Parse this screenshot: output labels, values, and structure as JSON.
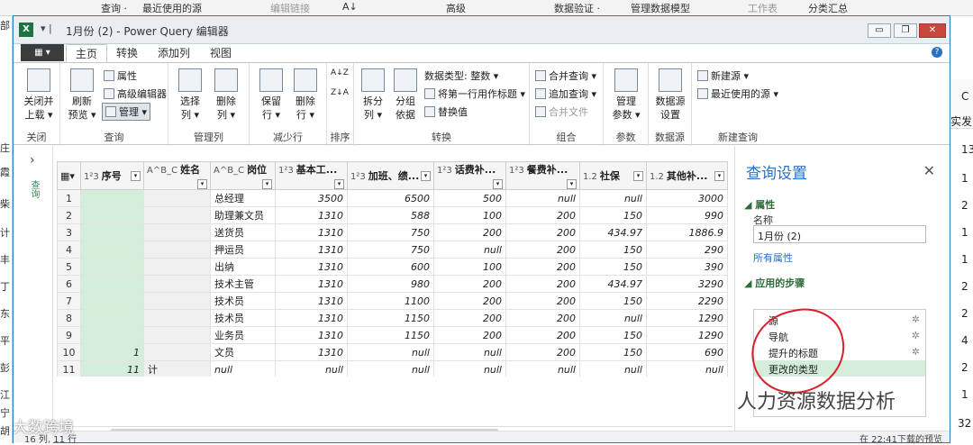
{
  "bg": {
    "toolbar": [
      "查询 ·",
      "最近使用的源",
      "编辑链接",
      "A↓",
      "高级",
      "数据验证 ·",
      "管理数据模型",
      "工作表",
      "分类汇总"
    ],
    "left_chars": [
      "部",
      "庄",
      "霞",
      "柴",
      "计",
      "丰",
      "丁",
      "东",
      "平",
      "彭",
      "江",
      "宁",
      "胡"
    ],
    "right_col": [
      "C",
      "实发",
      "13",
      "1",
      "2",
      "1",
      "1",
      "2",
      "2",
      "4",
      "2",
      "1",
      "32"
    ]
  },
  "window": {
    "title": "1月份 (2) - Power Query 编辑器",
    "qa": "▾ |",
    "minimize": "▭",
    "restore": "❐",
    "close": "✕"
  },
  "tabs": {
    "file": "▦ ▾",
    "items": [
      "主页",
      "转换",
      "添加列",
      "视图"
    ],
    "help": "?"
  },
  "ribbon": {
    "close_upload": [
      "关闭并",
      "上载 ▾"
    ],
    "refresh_preview": [
      "刷新",
      "预览 ▾"
    ],
    "properties": "属性",
    "advanced_editor": "高级编辑器",
    "manage": "管理 ▾",
    "choose_cols": [
      "选择",
      "列 ▾"
    ],
    "remove_cols": [
      "删除",
      "列 ▾"
    ],
    "keep_rows": [
      "保留",
      "行 ▾"
    ],
    "remove_rows": [
      "删除",
      "行 ▾"
    ],
    "sort_asc": "A↓Z",
    "sort_desc": "Z↓A",
    "split_col": [
      "拆分",
      "列 ▾"
    ],
    "group_by": [
      "分组",
      "依据"
    ],
    "data_type": "数据类型: 整数 ▾",
    "first_row_header": "将第一行用作标题 ▾",
    "replace_values": "替换值",
    "merge_queries": "合并查询 ▾",
    "append_queries": "追加查询 ▾",
    "combine_files": "合并文件",
    "manage_params": [
      "管理",
      "参数 ▾"
    ],
    "datasource_settings": [
      "数据源",
      "设置"
    ],
    "new_source": "新建源 ▾",
    "recent_sources": "最近使用的源 ▾",
    "groups": [
      "关闭",
      "查询",
      "管理列",
      "减少行",
      "排序",
      "转换",
      "组合",
      "参数",
      "数据源",
      "新建查询"
    ]
  },
  "nav": {
    "chevron": "›",
    "label": "查询"
  },
  "columns": [
    {
      "type": "1²3",
      "name": "序号"
    },
    {
      "type": "A^B_C",
      "name": "姓名"
    },
    {
      "type": "A^B_C",
      "name": "岗位"
    },
    {
      "type": "1²3",
      "name": "基本工..."
    },
    {
      "type": "1²3",
      "name": "加班、绩..."
    },
    {
      "type": "1²3",
      "name": "话费补..."
    },
    {
      "type": "1²3",
      "name": "餐费补..."
    },
    {
      "type": "1.2",
      "name": "社保"
    },
    {
      "type": "1.2",
      "name": "其他补..."
    }
  ],
  "rows": [
    {
      "n": "1",
      "seq": "",
      "name": "",
      "post": "总经理",
      "base": "3500",
      "bonus": "6500",
      "phone": "500",
      "meal": "null",
      "ss": "null",
      "other": "3000"
    },
    {
      "n": "2",
      "seq": "",
      "name": "",
      "post": "助理兼文员",
      "base": "1310",
      "bonus": "588",
      "phone": "100",
      "meal": "200",
      "ss": "150",
      "other": "990"
    },
    {
      "n": "3",
      "seq": "",
      "name": "",
      "post": "送货员",
      "base": "1310",
      "bonus": "750",
      "phone": "200",
      "meal": "200",
      "ss": "434.97",
      "other": "1886.9"
    },
    {
      "n": "4",
      "seq": "",
      "name": "",
      "post": "押运员",
      "base": "1310",
      "bonus": "750",
      "phone": "null",
      "meal": "200",
      "ss": "150",
      "other": "290"
    },
    {
      "n": "5",
      "seq": "",
      "name": "",
      "post": "出纳",
      "base": "1310",
      "bonus": "600",
      "phone": "100",
      "meal": "200",
      "ss": "150",
      "other": "390"
    },
    {
      "n": "6",
      "seq": "",
      "name": "",
      "post": "技术主管",
      "base": "1310",
      "bonus": "980",
      "phone": "200",
      "meal": "200",
      "ss": "434.97",
      "other": "3290"
    },
    {
      "n": "7",
      "seq": "",
      "name": "",
      "post": "技术员",
      "base": "1310",
      "bonus": "1100",
      "phone": "200",
      "meal": "200",
      "ss": "150",
      "other": "2290"
    },
    {
      "n": "8",
      "seq": "",
      "name": "",
      "post": "技术员",
      "base": "1310",
      "bonus": "1150",
      "phone": "200",
      "meal": "200",
      "ss": "null",
      "other": "1290"
    },
    {
      "n": "9",
      "seq": "",
      "name": "",
      "post": "业务员",
      "base": "1310",
      "bonus": "1150",
      "phone": "200",
      "meal": "200",
      "ss": "150",
      "other": "1290"
    },
    {
      "n": "10",
      "seq": "1",
      "name": "",
      "post": "文员",
      "base": "1310",
      "bonus": "null",
      "phone": "null",
      "meal": "200",
      "ss": "150",
      "other": "690"
    },
    {
      "n": "11",
      "seq": "11",
      "name": "计",
      "post": "null",
      "base": "null",
      "bonus": "null",
      "phone": "null",
      "meal": "null",
      "ss": "null",
      "other": "null"
    }
  ],
  "status": {
    "left": "16 列, 11 行",
    "right": "在 22:41下载的预览"
  },
  "query_settings": {
    "title": "查询设置",
    "close": "✕",
    "props_section": "◢ 属性",
    "name_label": "名称",
    "name_value": "1月份 (2)",
    "all_props": "所有属性",
    "steps_section": "◢ 应用的步骤",
    "steps": [
      {
        "label": "源",
        "gear": "✲"
      },
      {
        "label": "导航",
        "gear": "✲"
      },
      {
        "label": "提升的标题",
        "gear": "✲"
      },
      {
        "label": "更改的类型",
        "gear": ""
      }
    ]
  },
  "watermark": {
    "left": "大数跨境",
    "right": "人力资源数据分析"
  }
}
